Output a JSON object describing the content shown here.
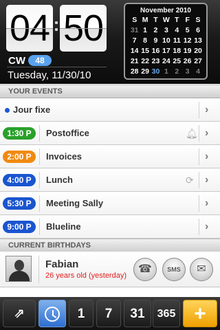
{
  "header": {
    "clock": {
      "hours": "04",
      "minutes": "50"
    },
    "cw_label": "CW",
    "cw_number": "48",
    "date": "Tuesday, 11/30/10"
  },
  "calendar": {
    "title": "November 2010",
    "weekdays": [
      "S",
      "M",
      "T",
      "W",
      "T",
      "F",
      "S"
    ],
    "weeks": [
      [
        {
          "d": "31",
          "dim": true
        },
        {
          "d": "1"
        },
        {
          "d": "2"
        },
        {
          "d": "3"
        },
        {
          "d": "4"
        },
        {
          "d": "5"
        },
        {
          "d": "6"
        }
      ],
      [
        {
          "d": "7"
        },
        {
          "d": "8"
        },
        {
          "d": "9"
        },
        {
          "d": "10"
        },
        {
          "d": "11"
        },
        {
          "d": "12"
        },
        {
          "d": "13"
        }
      ],
      [
        {
          "d": "14"
        },
        {
          "d": "15"
        },
        {
          "d": "16"
        },
        {
          "d": "17"
        },
        {
          "d": "18"
        },
        {
          "d": "19"
        },
        {
          "d": "20"
        }
      ],
      [
        {
          "d": "21"
        },
        {
          "d": "22"
        },
        {
          "d": "23"
        },
        {
          "d": "24"
        },
        {
          "d": "25"
        },
        {
          "d": "26"
        },
        {
          "d": "27"
        }
      ],
      [
        {
          "d": "28"
        },
        {
          "d": "29"
        },
        {
          "d": "30",
          "today": true
        },
        {
          "d": "1",
          "dim": true
        },
        {
          "d": "2",
          "dim": true
        },
        {
          "d": "3",
          "dim": true
        },
        {
          "d": "4",
          "dim": true
        }
      ]
    ]
  },
  "sections": {
    "events": "YOUR EVENTS",
    "birthdays": "CURRENT BIRTHDAYS"
  },
  "events": [
    {
      "title": "Jour fixe",
      "allday": true,
      "color": "#1d57d5"
    },
    {
      "time": "1:30 P",
      "title": "Postoffice",
      "color": "#2aa02a",
      "icon": "bell-icon"
    },
    {
      "time": "2:00 P",
      "title": "Invoices",
      "color": "#f08a10"
    },
    {
      "time": "4:00 P",
      "title": "Lunch",
      "color": "#1a55d0",
      "icon": "repeat-icon"
    },
    {
      "time": "5:30 P",
      "title": "Meeting Sally",
      "color": "#1a55d0"
    },
    {
      "time": "9:00 P",
      "title": "Blueline",
      "color": "#1a55d0"
    }
  ],
  "birthday": {
    "name": "Fabian",
    "age_text": "26 years old (yesterday)",
    "sms_label": "SMS"
  },
  "toolbar": {
    "day1": "1",
    "day7": "7",
    "day31": "31",
    "day365": "365",
    "add": "+"
  }
}
